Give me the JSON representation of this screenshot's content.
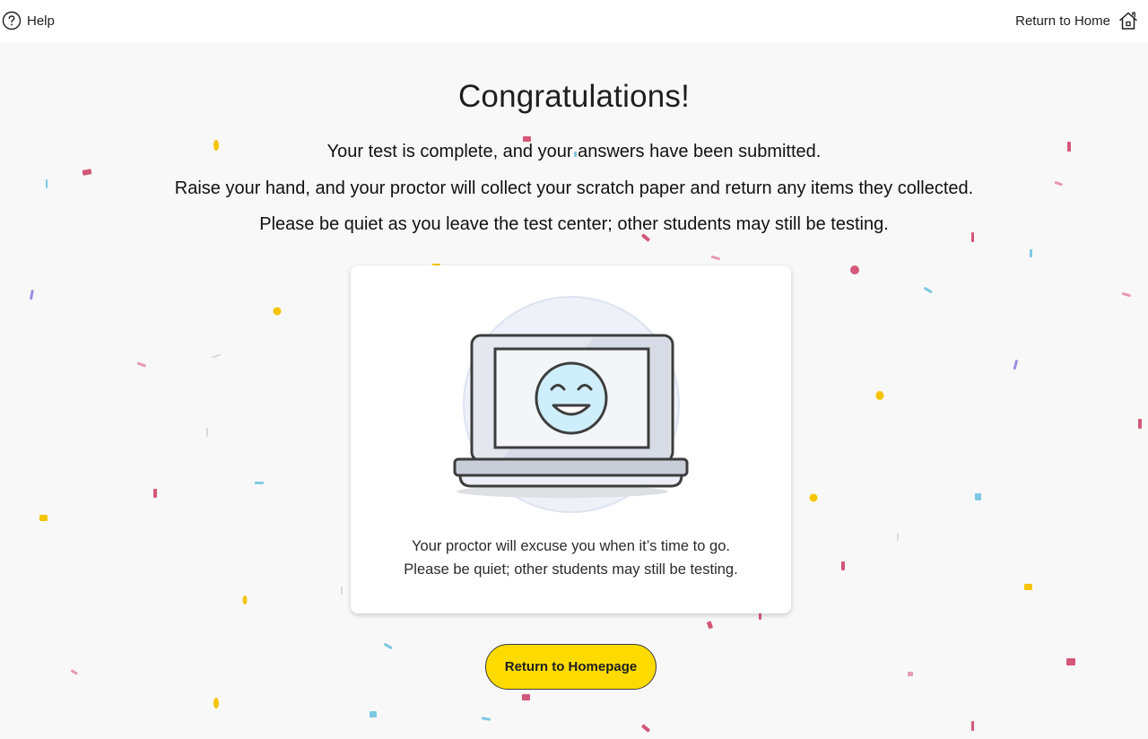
{
  "topbar": {
    "help_label": "Help",
    "home_label": "Return to Home"
  },
  "main": {
    "title": "Congratulations!",
    "messages": [
      "Your test is complete, and your answers have been submitted.",
      "Raise your hand, and your proctor will collect your scratch paper and return any items they collected.",
      "Please be quiet as you leave the test center; other students may still be testing."
    ]
  },
  "card": {
    "lines": [
      "Your proctor will excuse you when it’s time to go.",
      "Please be quiet; other students may still be testing."
    ]
  },
  "cta": {
    "label": "Return to Homepage"
  },
  "colors": {
    "accent_yellow": "#fedb00",
    "confetti_pink": "#d4587a",
    "confetti_blue": "#7ec8e3",
    "confetti_purple": "#9b8fe0",
    "face_fill": "#cfeefb"
  },
  "icons": {
    "help": "question-circle-icon",
    "home": "house-icon",
    "illustration": "laptop-smiley-illustration"
  }
}
